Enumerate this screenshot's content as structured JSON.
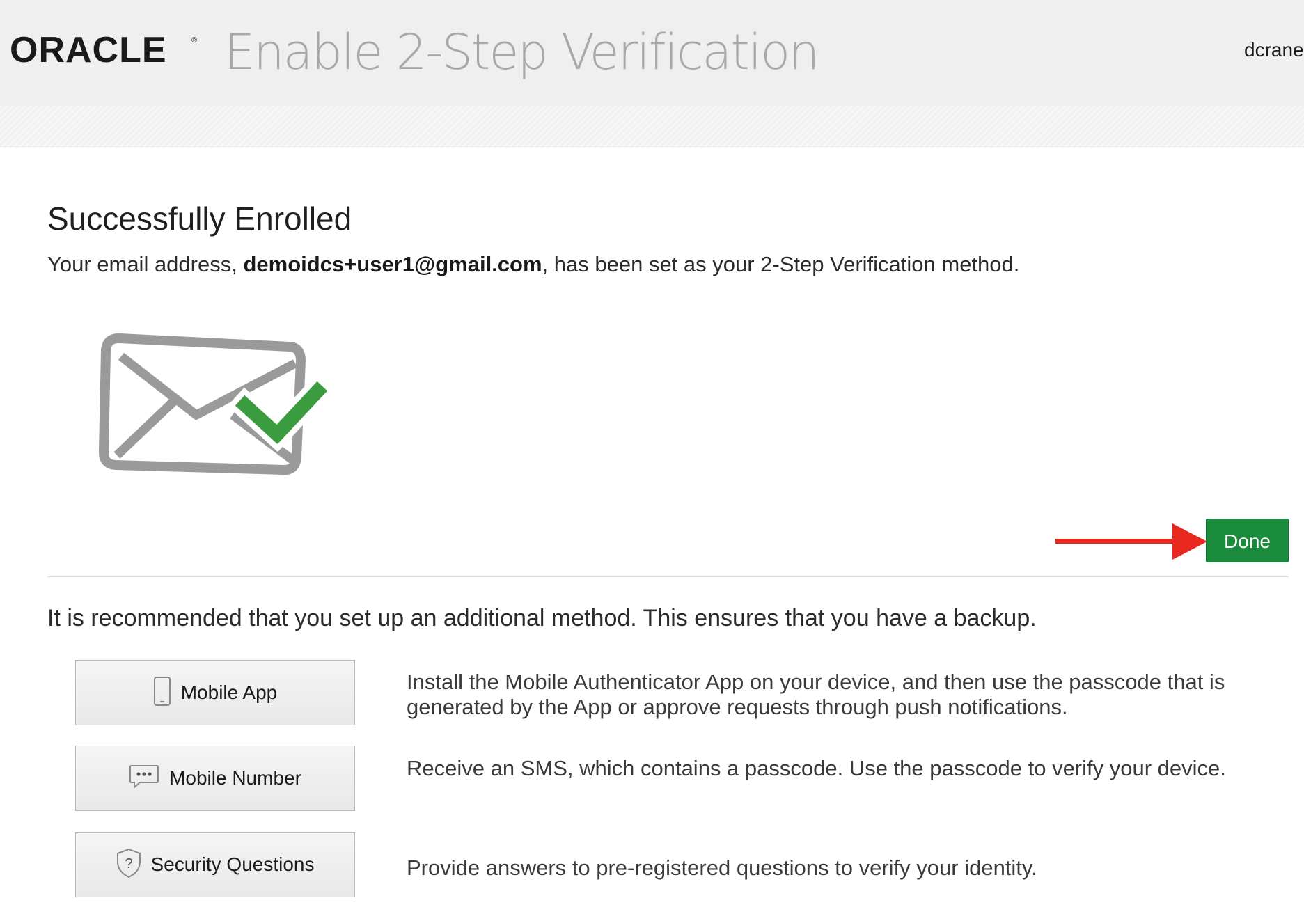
{
  "header": {
    "logo_text": "ORACLE",
    "logo_mark": "®",
    "title": "Enable 2-Step Verification",
    "username": "dcrane"
  },
  "success": {
    "title": "Successfully Enrolled",
    "message_prefix": "Your email address, ",
    "email": "demoidcs+user1@gmail.com",
    "message_suffix": ", has been set as your 2-Step Verification method."
  },
  "illustration_icon": "envelope-checkmark-icon",
  "done_button": "Done",
  "annotation_icon": "red-arrow-icon",
  "recommendation": "It is recommended that you set up an additional method. This ensures that you have a backup.",
  "methods": [
    {
      "label": "Mobile App",
      "icon": "mobile-phone-icon",
      "description": "Install the Mobile Authenticator App on your device, and then use the passcode that is generated by the App or approve requests through push notifications."
    },
    {
      "label": "Mobile Number",
      "icon": "chat-bubble-icon",
      "description": "Receive an SMS, which contains a passcode. Use the passcode to verify your device."
    },
    {
      "label": "Security Questions",
      "icon": "shield-question-icon",
      "description": "Provide answers to pre-registered questions to verify your identity."
    }
  ],
  "colors": {
    "header_bg": "#efefef",
    "done_green": "#1a8a3c",
    "check_green": "#3a9b3f",
    "arrow_red": "#e8281e",
    "envelope_gray": "#9a9a9a"
  }
}
